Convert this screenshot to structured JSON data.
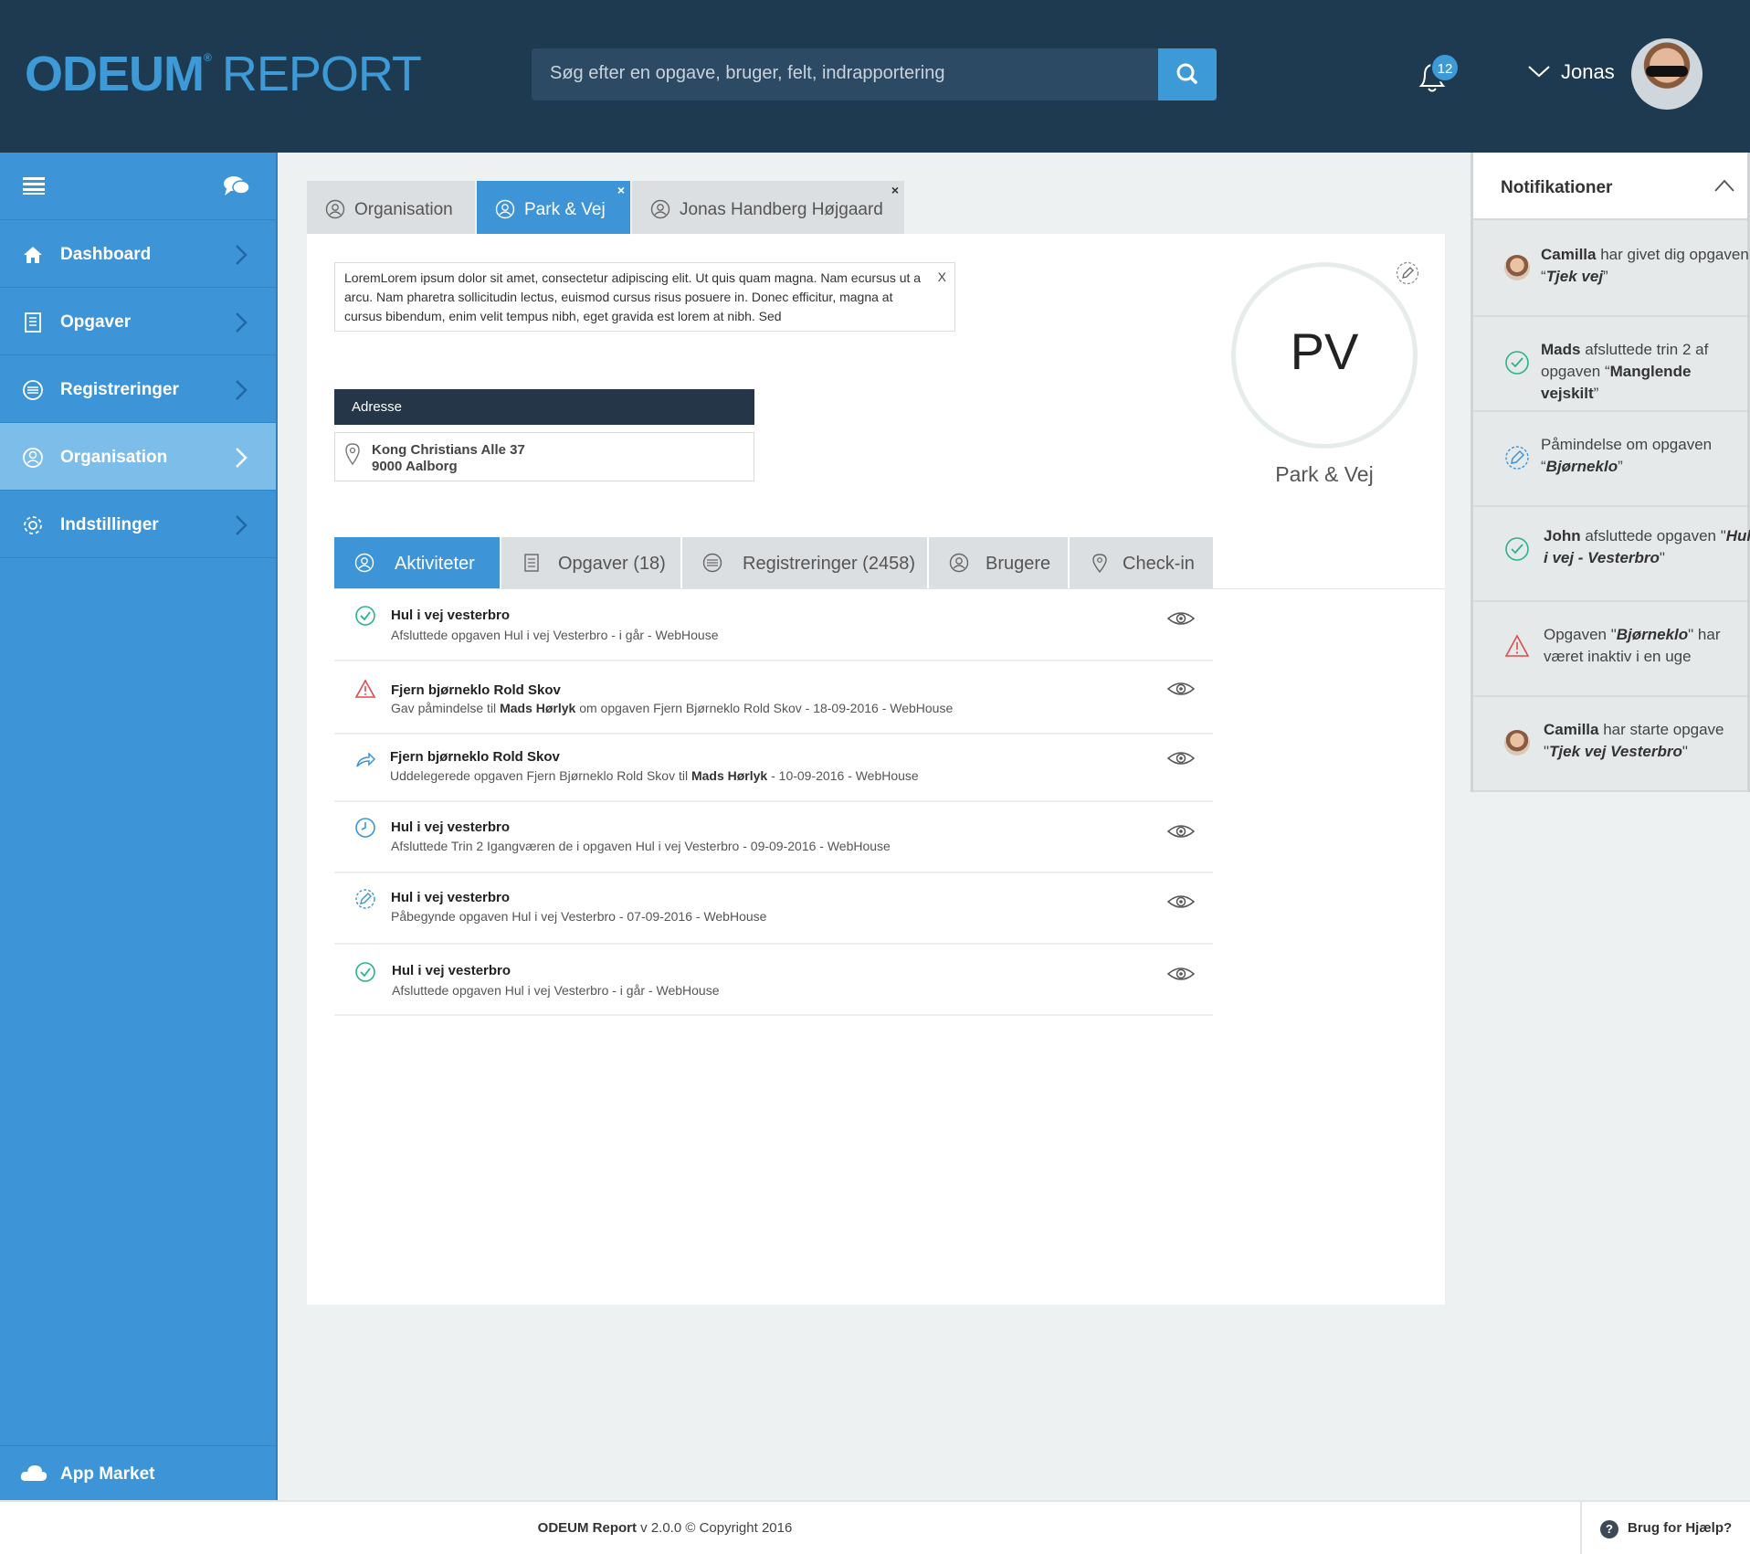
{
  "header": {
    "logo_primary": "ODEUM",
    "logo_mark": "®",
    "logo_secondary": "REPORT",
    "search_placeholder": "Søg efter en opgave, bruger, felt, indrapportering",
    "notification_count": "12",
    "user_name": "Jonas"
  },
  "sidebar": {
    "items": [
      {
        "label": "Dashboard",
        "icon": "home-icon"
      },
      {
        "label": "Opgaver",
        "icon": "tasks-icon"
      },
      {
        "label": "Registreringer",
        "icon": "list-icon"
      },
      {
        "label": "Organisation",
        "icon": "organisation-icon"
      },
      {
        "label": "Indstillinger",
        "icon": "gear-icon"
      }
    ],
    "app_market": "App Market"
  },
  "tabs": [
    {
      "label": "Organisation"
    },
    {
      "label": "Park & Vej",
      "close": "×"
    },
    {
      "label": "Jonas Handberg Højgaard",
      "close": "×"
    }
  ],
  "note": {
    "text": "LoremLorem ipsum dolor sit amet, consectetur adipiscing elit. Ut quis quam magna. Nam ecursus ut a arcu. Nam pharetra sollicitudin lectus, euismod cursus risus posuere in. Donec efficitur, magna at cursus bibendum, enim velit tempus nibh, eget gravida est lorem at nibh. Sed",
    "close": "X"
  },
  "address": {
    "heading": "Adresse",
    "line1": "Kong Christians Alle 37",
    "line2": "9000 Aalborg"
  },
  "org": {
    "initials": "PV",
    "name": "Park & Vej"
  },
  "subtabs": [
    {
      "label": "Aktiviteter"
    },
    {
      "label": "Opgaver (18)"
    },
    {
      "label": "Registreringer (2458)"
    },
    {
      "label": "Brugere"
    },
    {
      "label": "Check-in"
    }
  ],
  "activities": [
    {
      "title": "Hul i vej vesterbro",
      "pre": "Afsluttede opgaven Hul i vej Vesterbro  -  i går  -  WebHouse",
      "bold": "",
      "post": "",
      "icon": "check-circle-icon"
    },
    {
      "title": "Fjern bjørneklo Rold Skov",
      "pre": "Gav påmindelse til ",
      "bold": "Mads Hørlyk",
      "post": " om opgaven Fjern Bjørneklo Rold Skov   -  18-09-2016  -  WebHouse",
      "icon": "warning-icon"
    },
    {
      "title": "Fjern bjørneklo Rold Skov",
      "pre": "Uddelegerede opgaven Fjern Bjørneklo Rold Skov til ",
      "bold": "Mads Hørlyk",
      "post": "  -  10-09-2016  -  WebHouse",
      "icon": "forward-arrow-icon"
    },
    {
      "title": "Hul i vej vesterbro",
      "pre": "Afsluttede Trin 2 Igangværen de i opgaven Hul i vej Vesterbro  -  09-09-2016  -  WebHouse",
      "bold": "",
      "post": "",
      "icon": "clock-icon"
    },
    {
      "title": "Hul i vej vesterbro",
      "pre": "Påbegynde opgaven Hul i vej Vesterbro  -  07-09-2016  -  WebHouse",
      "bold": "",
      "post": "",
      "icon": "pencil-circle-icon"
    },
    {
      "title": "Hul i vej vesterbro",
      "pre": "Afsluttede opgaven Hul i vej Vesterbro  -  i går  -  WebHouse",
      "bold": "",
      "post": "",
      "icon": "check-circle-icon"
    }
  ],
  "notifications": {
    "title": "Notifikationer",
    "items": [
      {
        "b1": "Camilla",
        "t1": " har givet dig opgaven “",
        "i1": "Tjek vej",
        "t2": "”",
        "icon": "avatar"
      },
      {
        "b1": "Mads",
        "t1": " afsluttede trin 2 af opgaven “",
        "i1": "Manglende vejskilt",
        "t2": "”",
        "icon": "check-circle-icon"
      },
      {
        "b1": "",
        "t1": "Påmindelse om opgaven “",
        "i1": "Bjørneklo",
        "t2": "”",
        "icon": "pencil-circle-icon"
      },
      {
        "b1": "John",
        "t1": " afsluttede opgaven \"",
        "i1": "Hul i vej - Vesterbro",
        "t2": "\"",
        "icon": "check-circle-icon"
      },
      {
        "b1": "",
        "t1": "Opgaven \"",
        "i1": "Bjørneklo",
        "t2": "\" har været inaktiv i en uge",
        "icon": "warning-icon"
      },
      {
        "b1": "Camilla",
        "t1": " har starte opgave \"",
        "i1": "Tjek vej Vesterbro",
        "t2": "\"",
        "icon": "avatar"
      }
    ]
  },
  "footer": {
    "brand": "ODEUM Report",
    "copyright": " v 2.0.0 © Copyright 2016",
    "help": "Brug for Hjælp?"
  },
  "colors": {
    "header": "#1e3a50",
    "accent": "#3d94d6",
    "success": "#2ab38a",
    "warning": "#e04b4b"
  }
}
